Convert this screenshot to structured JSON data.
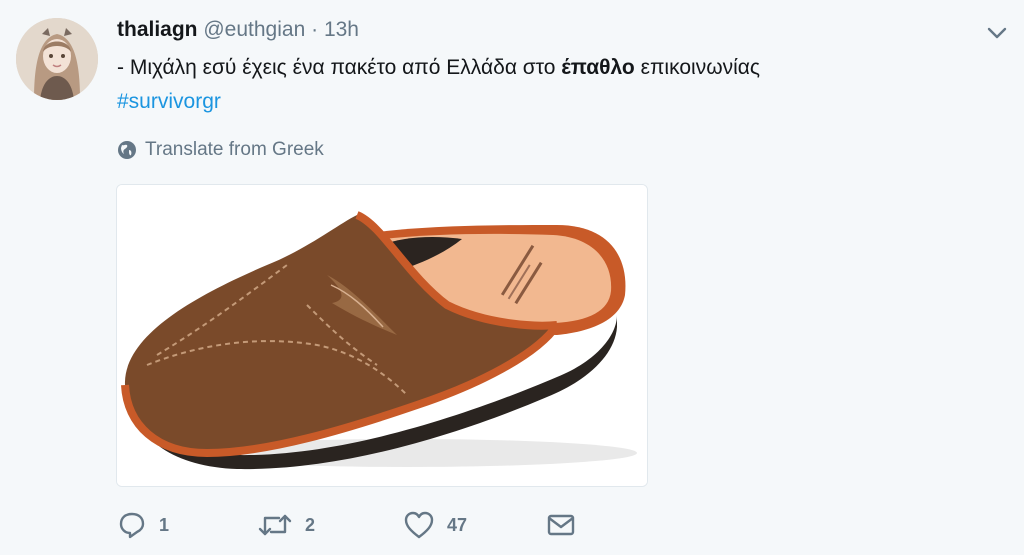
{
  "tweet": {
    "display_name": "thaliagn",
    "handle": "@euthgian",
    "separator": "·",
    "time": "13h",
    "text_before": "- Μιχάλη εσύ έχεις ένα πακέτο από Ελλάδα στο ",
    "text_bold": "έπαθλο",
    "text_after": " επικοινωνίας",
    "hashtag": "#survivorgr",
    "translate_label": "Translate from Greek",
    "reply_count": "1",
    "retweet_count": "2",
    "like_count": "47"
  },
  "colors": {
    "hashtag": "#1b95e0",
    "muted": "#657786",
    "slipper_brown": "#7a4a2a",
    "slipper_trim": "#c85a28",
    "insole": "#f2b890"
  },
  "icons": {
    "caret": "chevron-down-icon",
    "globe": "globe-icon",
    "reply": "reply-icon",
    "retweet": "retweet-icon",
    "like": "heart-icon",
    "message": "envelope-icon"
  }
}
